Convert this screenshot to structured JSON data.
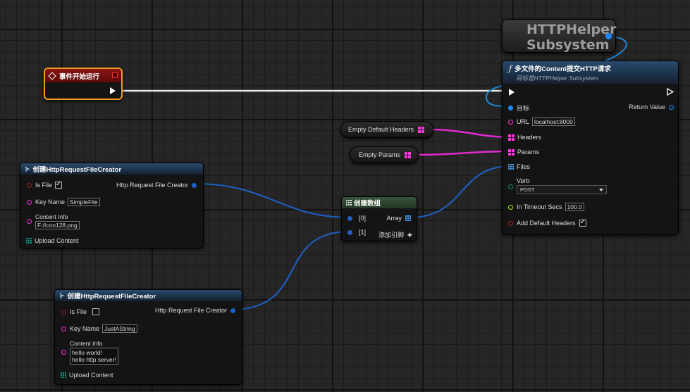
{
  "colors": {
    "exec": "#ffffff",
    "object": "#1e88ff",
    "string": "#ff2fd8",
    "map": "#ff2fd8",
    "bool": "#9a1f1f",
    "float": "#a0f000",
    "byte": "#0a8a6a",
    "event_border": "#f59b1f"
  },
  "subsystem_node": {
    "title_line1": "HTTPHelper",
    "title_line2": "Subsystem"
  },
  "event_node": {
    "title": "事件开始运行"
  },
  "function_node": {
    "title": "多文件的Content提交HTTP请求",
    "subtitle": "目标是HTTPHelper Subsystem",
    "target_label": "目标",
    "return_label": "Return Value",
    "url_label": "URL",
    "url_value": "localhost:8000",
    "headers_label": "Headers",
    "params_label": "Params",
    "files_label": "Files",
    "verb_label": "Verb",
    "verb_value": "POST",
    "timeout_label": "In Timeout Secs",
    "timeout_value": "100.0",
    "default_headers_label": "Add Default Headers"
  },
  "empty_headers": {
    "label": "Empty Default Headers"
  },
  "empty_params": {
    "label": "Empty Params"
  },
  "make_array": {
    "title": "创建数组",
    "pin0": "[0]",
    "pin1": "[1]",
    "array_label": "Array",
    "add_pin_label": "添加引脚"
  },
  "creator1": {
    "title": "创建HttpRequestFileCreator",
    "is_file_label": "Is File",
    "output_label": "Http Request File Creator",
    "key_label": "Key Name",
    "key_value": "SimpleFile",
    "content_label": "Content Info",
    "content_value": "F:/Icon128.png",
    "upload_label": "Upload Content"
  },
  "creator2": {
    "title": "创建HttpRequestFileCreator",
    "is_file_label": "Is File",
    "output_label": "Http Request File Creator",
    "key_label": "Key Name",
    "key_value": "JustAString",
    "content_label": "Content Info",
    "content_line1": "hello world!",
    "content_line2": "hello http server!",
    "upload_label": "Upload Content"
  }
}
